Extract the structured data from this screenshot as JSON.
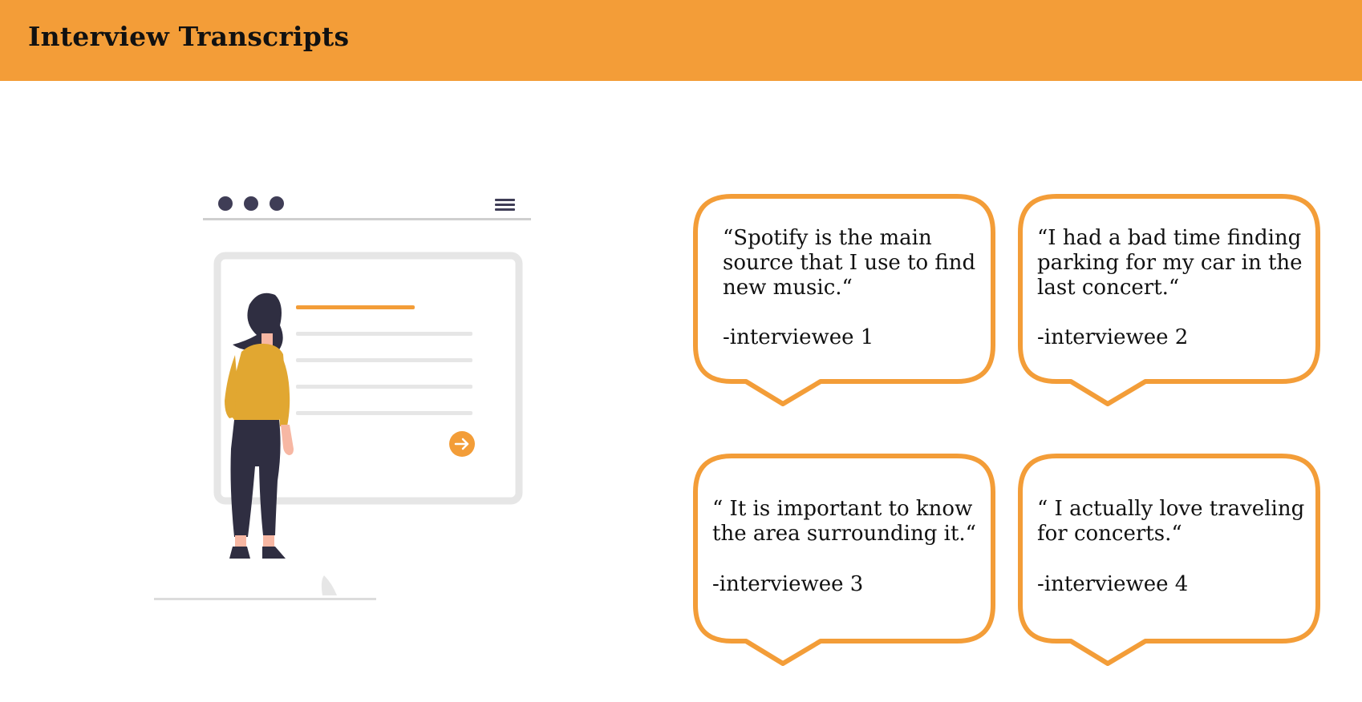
{
  "header": {
    "title": "Interview Transcripts"
  },
  "colors": {
    "accent": "#f39d38",
    "figure_shirt": "#e1a731",
    "figure_dark": "#2f2e41",
    "illustration_gray": "#e6e6e6"
  },
  "illustration": {
    "icon": "person-viewing-webpage-illustration"
  },
  "quotes": [
    {
      "text": "“Spotify is the main\nsource that I use to find\nnew music.“",
      "author": "-interviewee 1"
    },
    {
      "text": "“I had a bad time finding\nparking for my car in the\nlast concert.“",
      "author": "-interviewee 2"
    },
    {
      "text": "“ It is important to know\nthe area surrounding it.“",
      "author": "-interviewee 3"
    },
    {
      "text": "“  I actually love traveling\nfor concerts.“",
      "author": "-interviewee 4"
    }
  ]
}
